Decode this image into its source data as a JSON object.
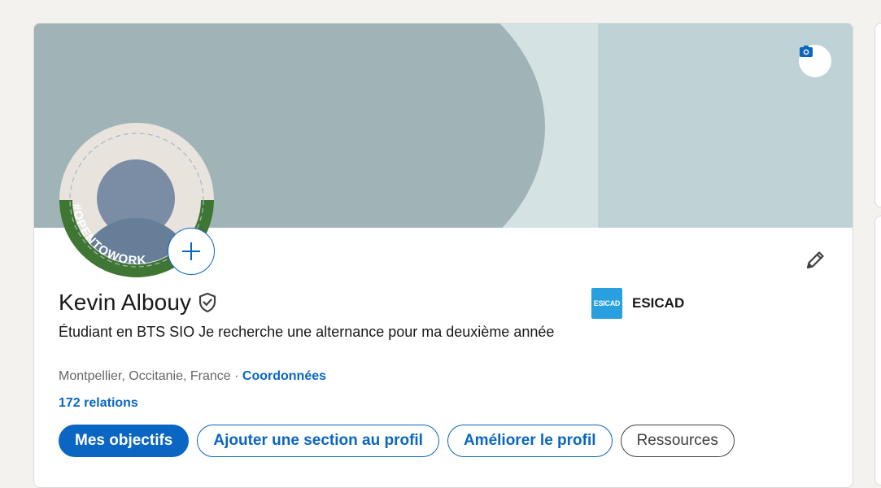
{
  "profile": {
    "name": "Kevin Albouy",
    "headline": "Étudiant en BTS SIO Je recherche une alternance pour ma deuxième année",
    "location": "Montpellier, Occitanie, France",
    "separator": "·",
    "contact_link": "Coordonnées",
    "relations": "172 relations",
    "frame_text": "#OPENTOWORK"
  },
  "school": {
    "logo_text": "ESICAD",
    "name": "ESICAD"
  },
  "actions": {
    "goals": "Mes objectifs",
    "add_section": "Ajouter une section au profil",
    "improve": "Améliorer le profil",
    "resources": "Ressources"
  },
  "icons": {
    "camera": "camera-icon",
    "plus": "plus-icon",
    "edit": "pencil-icon",
    "verified": "shield-check-icon"
  },
  "colors": {
    "accent": "#0a66c2",
    "open_to_work": "#3f7633",
    "banner_dark": "#a0b3b6",
    "banner_light": "#bfd2d6"
  }
}
